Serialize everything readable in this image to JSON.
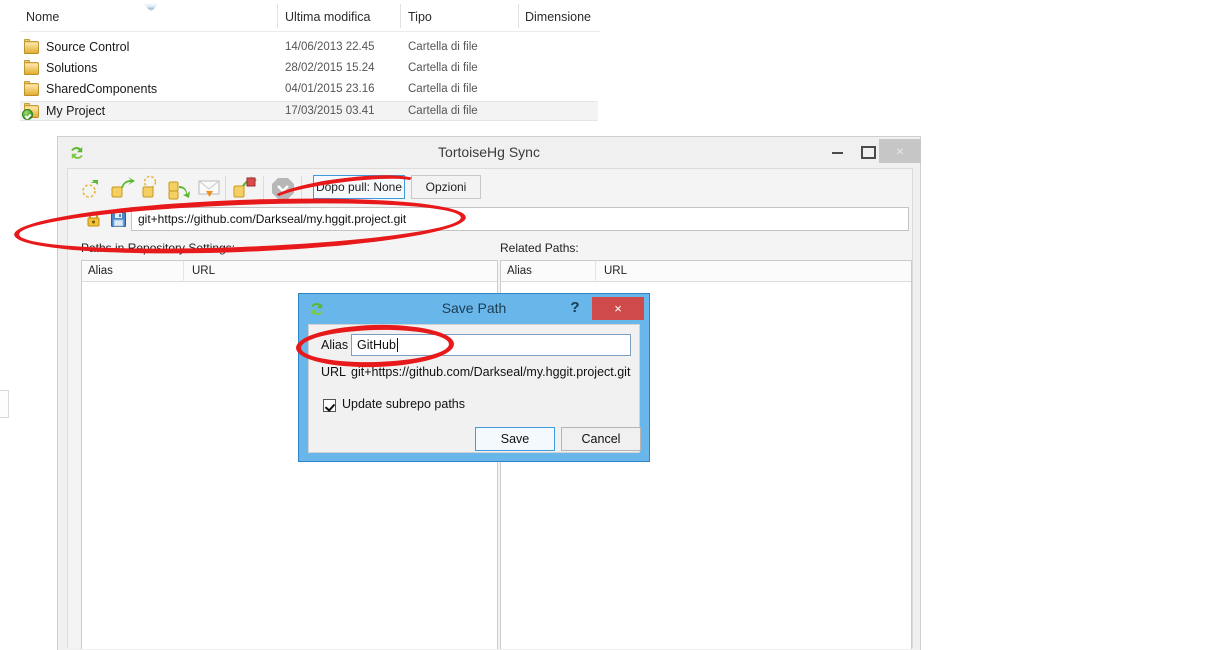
{
  "explorer": {
    "columns": [
      {
        "label": "Nome"
      },
      {
        "label": "Ultima modifica"
      },
      {
        "label": "Tipo"
      },
      {
        "label": "Dimensione"
      }
    ],
    "rows": [
      {
        "name": "Source Control",
        "modified": "14/06/2013 22.45",
        "type": "Cartella di file",
        "size": "",
        "icon": "folder-icon",
        "selected": false
      },
      {
        "name": "Solutions",
        "modified": "28/02/2015 15.24",
        "type": "Cartella di file",
        "size": "",
        "icon": "folder-icon",
        "selected": false
      },
      {
        "name": "SharedComponents",
        "modified": "04/01/2015 23.16",
        "type": "Cartella di file",
        "size": "",
        "icon": "folder-icon",
        "selected": false
      },
      {
        "name": "My Project",
        "modified": "17/03/2015 03.41",
        "type": "Cartella di file",
        "size": "",
        "icon": "folder-ok-icon",
        "selected": true
      }
    ]
  },
  "sync_window": {
    "title": "TortoiseHg Sync",
    "app_icon": "sync-refresh-icon",
    "window_buttons": {
      "minimize": "minimize-icon",
      "maximize": "maximize-icon",
      "close": "×"
    },
    "toolbar": {
      "icons": [
        "incoming-icon",
        "pull-icon",
        "outgoing-icon",
        "push-icon",
        "email-icon",
        "push-bookmark-icon",
        "stop-icon"
      ],
      "post_pull_label": "Dopo pull: None",
      "options_label": "Opzioni"
    },
    "url_row": {
      "security_icon": "lock-icon",
      "save_icon": "floppy-save-icon",
      "url": "git+https://github.com/Darkseal/my.hggit.project.git"
    },
    "left_pane": {
      "label": "Paths in Repository Settings:",
      "columns": [
        "Alias",
        "URL"
      ],
      "rows": []
    },
    "right_pane": {
      "label": "Related Paths:",
      "columns": [
        "Alias",
        "URL"
      ],
      "rows": []
    }
  },
  "save_path_dialog": {
    "title": "Save Path",
    "app_icon": "sync-refresh-icon",
    "help_label": "?",
    "close_label": "×",
    "alias_label": "Alias",
    "alias_value": "GitHub",
    "url_label": "URL",
    "url_value": "git+https://github.com/Darkseal/my.hggit.project.git",
    "checkbox_label": "Update subrepo paths",
    "checkbox_checked": true,
    "save_label": "Save",
    "cancel_label": "Cancel"
  },
  "annotations": {
    "color": "#e8191b",
    "ellipses": [
      {
        "name": "url-field-highlight"
      },
      {
        "name": "alias-field-highlight"
      },
      {
        "name": "toolbar-sweep-highlight"
      }
    ]
  }
}
